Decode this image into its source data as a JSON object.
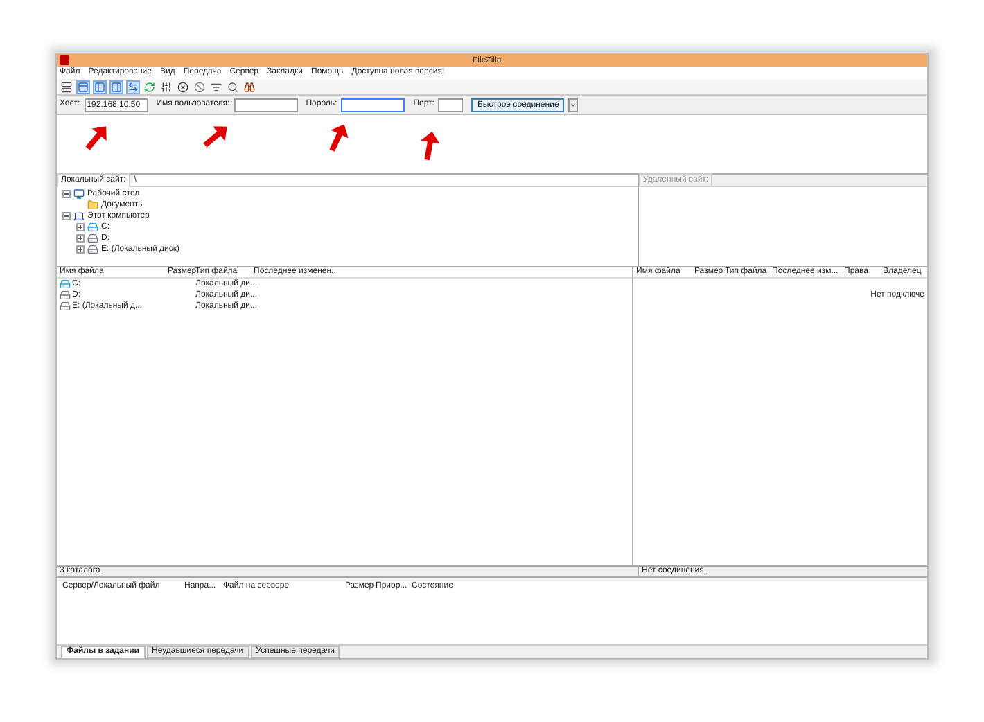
{
  "window": {
    "title": "FileZilla"
  },
  "menu": [
    "Файл",
    "Редактирование",
    "Вид",
    "Передача",
    "Сервер",
    "Закладки",
    "Помощь",
    "Доступна новая версия!"
  ],
  "quickconnect": {
    "host_label": "Хост:",
    "host": "192.168.10.50",
    "user_label": "Имя пользователя:",
    "password_label": "Пароль:",
    "port_label": "Порт:",
    "button": "Быстрое соединение"
  },
  "local_site": {
    "label": "Локальный сайт:",
    "path": "\\"
  },
  "remote_site": {
    "label": "Удаленный сайт:"
  },
  "local_tree": [
    {
      "label": "Рабочий стол",
      "kind": "desktop",
      "expanded": true,
      "children": [
        {
          "label": "Документы",
          "kind": "folder"
        }
      ]
    },
    {
      "label": "Этот компьютер",
      "kind": "computer",
      "expanded": true,
      "children": [
        {
          "label": "C:",
          "kind": "system-drive",
          "expanded": false
        },
        {
          "label": "D:",
          "kind": "drive",
          "expanded": false
        },
        {
          "label": "E: (Локальный диск)",
          "kind": "drive",
          "expanded": false
        }
      ]
    }
  ],
  "local_files": {
    "columns": [
      "Имя файла",
      "Размер",
      "Тип файла",
      "Последнее изменен..."
    ],
    "rows": [
      {
        "name": "C:",
        "kind": "system-drive",
        "type": "Локальный ди..."
      },
      {
        "name": "D:",
        "kind": "drive",
        "type": "Локальный ди..."
      },
      {
        "name": "E: (Локальный д...",
        "kind": "drive",
        "type": "Локальный ди..."
      }
    ]
  },
  "remote_files": {
    "columns": [
      "Имя файла",
      "Размер",
      "Тип файла",
      "Последнее изм...",
      "Права",
      "Владелец"
    ],
    "message": "Нет подключе"
  },
  "local_status": "3 каталога",
  "remote_status": "Нет соединения.",
  "queue": {
    "columns": [
      "Сервер/Локальный файл",
      "Напра...",
      "Файл на сервере",
      "Размер",
      "Приор...",
      "Состояние"
    ]
  },
  "queue_tabs": [
    {
      "label": "Файлы в задании",
      "selected": true
    },
    {
      "label": "Неудавшиеся передачи",
      "selected": false
    },
    {
      "label": "Успешные передачи",
      "selected": false
    }
  ]
}
